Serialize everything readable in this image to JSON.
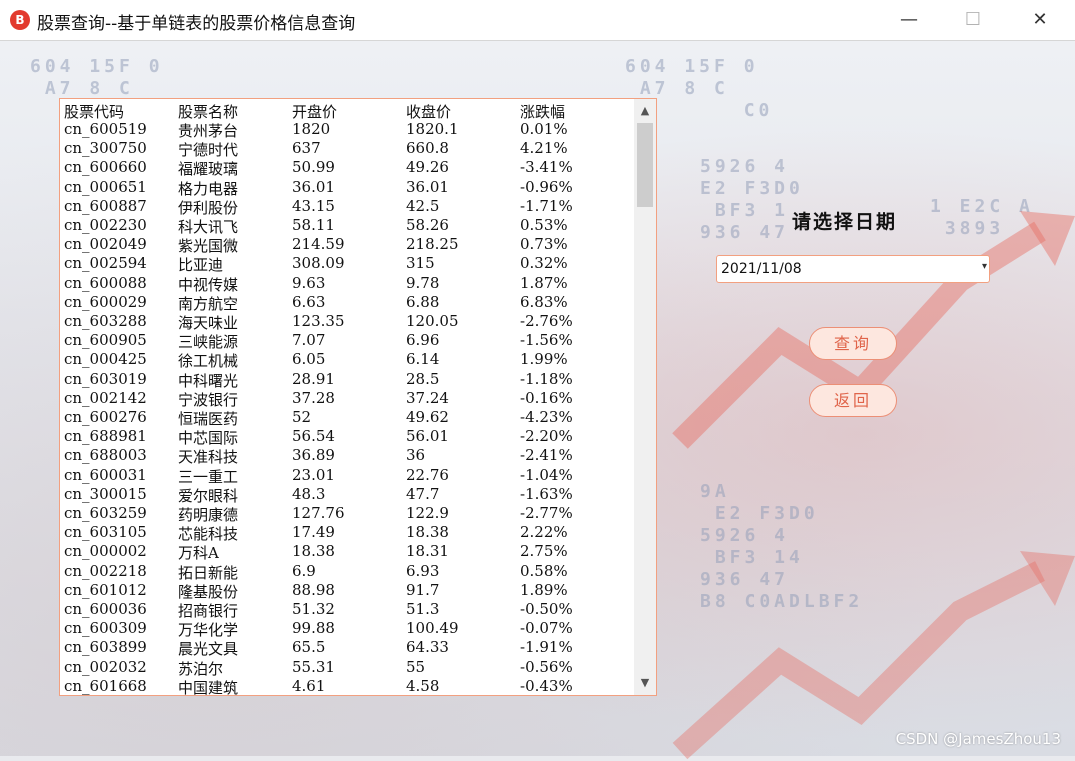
{
  "window": {
    "title": "股票查询--基于单链表的股票价格信息查询",
    "icon_label": "B",
    "minimize_glyph": "—",
    "maximize_glyph": "☐",
    "close_glyph": "✕"
  },
  "background": {
    "digits_a": "604 15F 0\n A7 8 C",
    "digits_b": "604 15F 0\n A7 8 C\n        C0",
    "digits_c": "5926 4\nE2 F3D0\n BF3 1\n936 47",
    "digits_d": "9A\n E2 F3D0\n5926 4\n BF3 14\n936 47\nB8 C0ADLBF2",
    "digits_e": "1 E2C A\n 3893"
  },
  "stock_list": {
    "headers": [
      "股票代码",
      "股票名称",
      "开盘价",
      "收盘价",
      "涨跌幅"
    ],
    "rows": [
      [
        "cn_600519",
        "贵州茅台",
        "1820",
        "1820.1",
        "0.01%"
      ],
      [
        "cn_300750",
        "宁德时代",
        "637",
        "660.8",
        "4.21%"
      ],
      [
        "cn_600660",
        "福耀玻璃",
        "50.99",
        "49.26",
        "-3.41%"
      ],
      [
        "cn_000651",
        "格力电器",
        "36.01",
        "36.01",
        "-0.96%"
      ],
      [
        "cn_600887",
        "伊利股份",
        "43.15",
        "42.5",
        "-1.71%"
      ],
      [
        "cn_002230",
        "科大讯飞",
        "58.11",
        "58.26",
        "0.53%"
      ],
      [
        "cn_002049",
        "紫光国微",
        "214.59",
        "218.25",
        "0.73%"
      ],
      [
        "cn_002594",
        "比亚迪",
        "308.09",
        "315",
        "0.32%"
      ],
      [
        "cn_600088",
        "中视传媒",
        "9.63",
        "9.78",
        "1.87%"
      ],
      [
        "cn_600029",
        "南方航空",
        "6.63",
        "6.88",
        "6.83%"
      ],
      [
        "cn_603288",
        "海天味业",
        "123.35",
        "120.05",
        "-2.76%"
      ],
      [
        "cn_600905",
        "三峡能源",
        "7.07",
        "6.96",
        "-1.56%"
      ],
      [
        "cn_000425",
        "徐工机械",
        "6.05",
        "6.14",
        "1.99%"
      ],
      [
        "cn_603019",
        "中科曙光",
        "28.91",
        "28.5",
        "-1.18%"
      ],
      [
        "cn_002142",
        "宁波银行",
        "37.28",
        "37.24",
        "-0.16%"
      ],
      [
        "cn_600276",
        "恒瑞医药",
        "52",
        "49.62",
        "-4.23%"
      ],
      [
        "cn_688981",
        "中芯国际",
        "56.54",
        "56.01",
        "-2.20%"
      ],
      [
        "cn_688003",
        "天准科技",
        "36.89",
        "36",
        "-2.41%"
      ],
      [
        "cn_600031",
        "三一重工",
        "23.01",
        "22.76",
        "-1.04%"
      ],
      [
        "cn_300015",
        "爱尔眼科",
        "48.3",
        "47.7",
        "-1.63%"
      ],
      [
        "cn_603259",
        "药明康德",
        "127.76",
        "122.9",
        "-2.77%"
      ],
      [
        "cn_603105",
        "芯能科技",
        "17.49",
        "18.38",
        "2.22%"
      ],
      [
        "cn_000002",
        "万科A",
        "18.38",
        "18.31",
        "2.75%"
      ],
      [
        "cn_002218",
        "拓日新能",
        "6.9",
        "6.93",
        "0.58%"
      ],
      [
        "cn_601012",
        "隆基股份",
        "88.98",
        "91.7",
        "1.89%"
      ],
      [
        "cn_600036",
        "招商银行",
        "51.32",
        "51.3",
        "-0.50%"
      ],
      [
        "cn_600309",
        "万华化学",
        "99.88",
        "100.49",
        "-0.07%"
      ],
      [
        "cn_603899",
        "晨光文具",
        "65.5",
        "64.33",
        "-1.91%"
      ],
      [
        "cn_002032",
        "苏泊尔",
        "55.31",
        "55",
        "-0.56%"
      ],
      [
        "cn_601668",
        "中国建筑",
        "4.61",
        "4.58",
        "-0.43%"
      ]
    ],
    "scroll_up_glyph": "▲",
    "scroll_down_glyph": "▼"
  },
  "controls": {
    "date_label": "请选择日期",
    "date_value": "2021/11/08",
    "date_arrow_glyph": "▾",
    "query_button": "查询",
    "back_button": "返回"
  },
  "watermark": "CSDN @JamesZhou13",
  "colors": {
    "accent_border": "#f2a080",
    "button_text": "#e0644a",
    "button_bg": "#fde7df"
  }
}
